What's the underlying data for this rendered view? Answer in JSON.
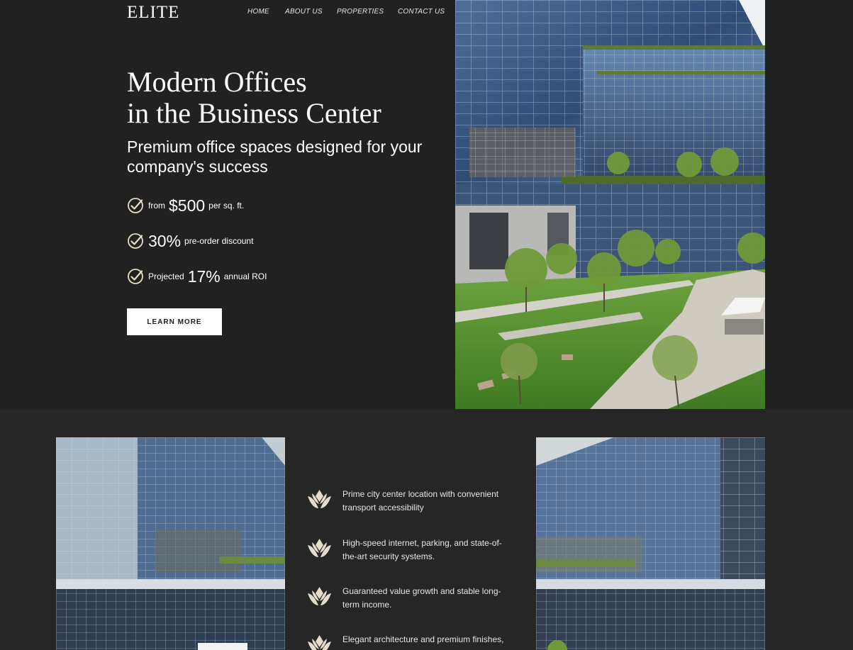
{
  "brand": {
    "logo": "ELITE"
  },
  "nav": {
    "items": [
      "HOME",
      "ABOUT US",
      "PROPERTIES",
      "CONTACT US"
    ]
  },
  "hero": {
    "title_line1": "Modern Offices",
    "title_line2": "in the Business Center",
    "subtitle": "Premium office spaces designed for your company's success",
    "features": [
      {
        "prefix": "from",
        "value": "$500",
        "suffix": "per sq. ft."
      },
      {
        "prefix": "",
        "value": "30%",
        "suffix": "pre-order discount"
      },
      {
        "prefix": "Projected",
        "value": "17%",
        "suffix": "annual ROI"
      }
    ],
    "cta_label": "LEARN MORE"
  },
  "benefits": [
    "Prime city center location with convenient transport accessibility",
    "High-speed internet, parking, and state-of-the-art security systems.",
    "Guaranteed value growth and stable long-term income.",
    "Elegant architecture and premium finishes,"
  ],
  "colors": {
    "hero_bg": "#212121",
    "page_bg": "#262626",
    "accent_cream": "#e8dcc4",
    "button_bg": "#ffffff"
  }
}
